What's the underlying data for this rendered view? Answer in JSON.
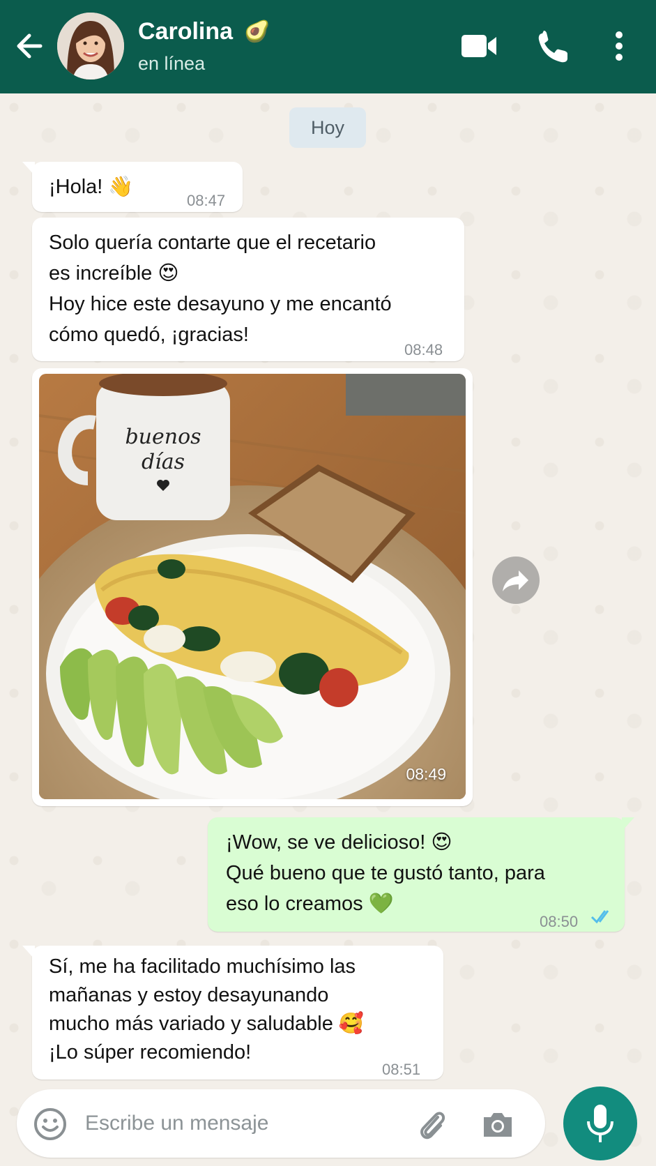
{
  "header": {
    "contact_name": "Carolina",
    "contact_emoji": "🥑",
    "status": "en línea",
    "icons": [
      "back-arrow-icon",
      "video-call-icon",
      "phone-call-icon",
      "more-options-icon"
    ]
  },
  "chat": {
    "day_label": "Hoy",
    "messages": [
      {
        "direction": "in",
        "text": "¡Hola! 👋",
        "time": "08:47"
      },
      {
        "direction": "in",
        "text": "Solo quería contarte que el recetario\nes increíble 😍\nHoy hice este desayuno y me encantó\ncómo quedó, ¡gracias!",
        "time": "08:48"
      },
      {
        "direction": "in",
        "type": "image",
        "time": "08:49",
        "mug_text": "buenos\ndías"
      },
      {
        "direction": "out",
        "text": "¡Wow, se ve delicioso! 😍\nQué bueno que te gustó tanto, para\neso lo creamos 💚",
        "time": "08:50",
        "read": true
      },
      {
        "direction": "in",
        "text": "Sí, me ha facilitado muchísimo las\nmañanas y estoy desayunando\nmucho más variado y saludable 🥰\n¡Lo súper recomiendo!",
        "time": "08:51"
      }
    ]
  },
  "composer": {
    "placeholder": "Escribe un mensaje",
    "icons": [
      "emoji-icon",
      "attach-icon",
      "camera-icon",
      "microphone-icon"
    ]
  },
  "colors": {
    "header": "#0b5c4d",
    "outgoing_bubble": "#d9fdd3",
    "incoming_bubble": "#ffffff",
    "mic_button": "#128c7e",
    "read_ticks": "#53bdeb"
  }
}
